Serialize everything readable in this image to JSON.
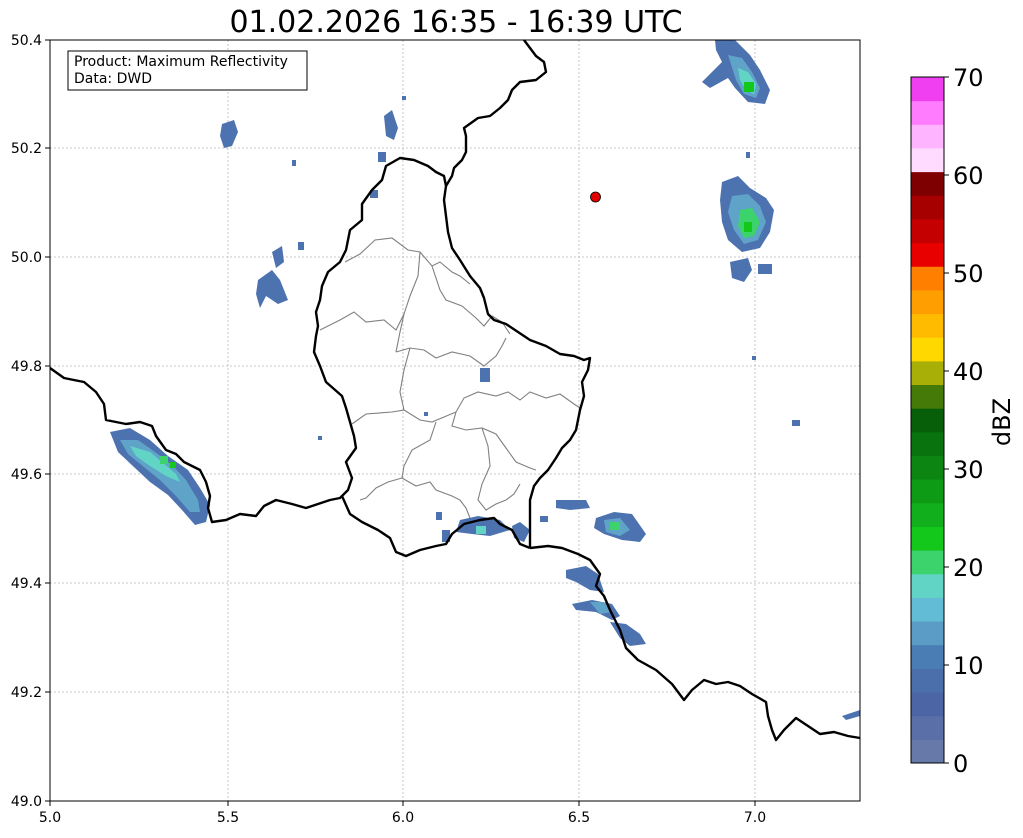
{
  "title": "01.02.2026 16:35 - 16:39 UTC",
  "info_box": {
    "line1": "Product: Maximum Reflectivity",
    "line2": "Data: DWD"
  },
  "map": {
    "lon_range": [
      5.0,
      7.3
    ],
    "lat_range": [
      49.0,
      50.4
    ],
    "x_ticks": [
      "5.0",
      "5.5",
      "6.0",
      "6.5",
      "7.0"
    ],
    "y_ticks": [
      "49.0",
      "49.2",
      "49.4",
      "49.6",
      "49.8",
      "50.0",
      "50.2",
      "50.4"
    ],
    "grid": true,
    "marker": {
      "lon": 6.545,
      "lat": 50.11,
      "color": "#e00000"
    }
  },
  "colorbar": {
    "label": "dBZ",
    "min": 0,
    "max": 70,
    "tick_labels": [
      "0",
      "10",
      "20",
      "30",
      "40",
      "50",
      "60",
      "70"
    ],
    "colors": [
      "#6779a8",
      "#5a6ea8",
      "#4c65a4",
      "#4a6faa",
      "#4a7db4",
      "#5a9cc6",
      "#63bcd5",
      "#62d4c6",
      "#3cd36d",
      "#14c81b",
      "#11af1b",
      "#0d9a14",
      "#0c8512",
      "#09740d",
      "#075f0a",
      "#457a08",
      "#a8b008",
      "#ffd800",
      "#ffbb00",
      "#ff9e00",
      "#ff7f00",
      "#e80000",
      "#c40000",
      "#a60000",
      "#7e0000",
      "#ffdcff",
      "#ffb4ff",
      "#ff7cff",
      "#f03ff0"
    ]
  }
}
